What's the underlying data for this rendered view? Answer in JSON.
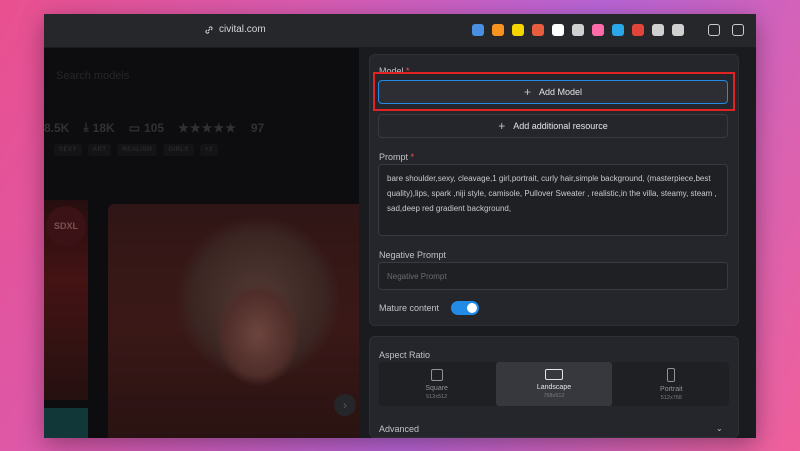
{
  "browser": {
    "url": "civital.com",
    "extension_icons": [
      {
        "name": "palette-extension-icon",
        "color": "#4a90e2"
      },
      {
        "name": "orange-circle-extension-icon",
        "color": "#f7931e"
      },
      {
        "name": "r-extension-icon",
        "color": "#f5d400"
      },
      {
        "name": "pinwheel-extension-icon",
        "color": "#e85d3f"
      },
      {
        "name": "notion-extension-icon",
        "color": "#ffffff"
      },
      {
        "name": "half-square-extension-icon",
        "color": "#d0d0d0"
      },
      {
        "name": "music-extension-icon",
        "color": "#ff6aa8"
      },
      {
        "name": "s-extension-icon",
        "color": "#2aa7e8"
      },
      {
        "name": "red-card-extension-icon",
        "color": "#e2453a"
      },
      {
        "name": "grid-menu-icon",
        "color": "#d0d0d0"
      },
      {
        "name": "chat-extension-icon",
        "color": "#d0d0d0"
      }
    ]
  },
  "left": {
    "search_placeholder": "Search models",
    "stats": {
      "downloads_a": "8.5K",
      "downloads": "18K",
      "comments": "105",
      "stars": "★★★★★",
      "rating_count": "97"
    },
    "tags": [
      "SEXY",
      "ART",
      "REALISM",
      "GIRLS",
      "+3"
    ],
    "badge": "SDXL"
  },
  "form": {
    "model_label": "Model",
    "required_mark": "*",
    "add_model_label": "Add Model",
    "add_resource_label": "Add additional resource",
    "prompt_label": "Prompt",
    "prompt_value": "bare shoulder,sexy, cleavage,1 girl,portrait, curly hair,simple background, (masterpiece,best quality),lips, spark ,niji style, camisole, Pullover Sweater , realistic,in the villa, steamy, steam , sad,deep red gradient background,",
    "negative_prompt_label": "Negative Prompt",
    "negative_prompt_placeholder": "Negative Prompt",
    "mature_label": "Mature content",
    "mature_enabled": true
  },
  "aspect": {
    "label": "Aspect Ratio",
    "options": [
      {
        "name": "Square",
        "dims": "512x512",
        "selected": false
      },
      {
        "name": "Landscape",
        "dims": "768x512",
        "selected": true
      },
      {
        "name": "Portrait",
        "dims": "512x768",
        "selected": false
      }
    ],
    "advanced_label": "Advanced"
  },
  "colors": {
    "accent": "#228be6",
    "highlight": "#e02424",
    "required": "#fa5252"
  }
}
